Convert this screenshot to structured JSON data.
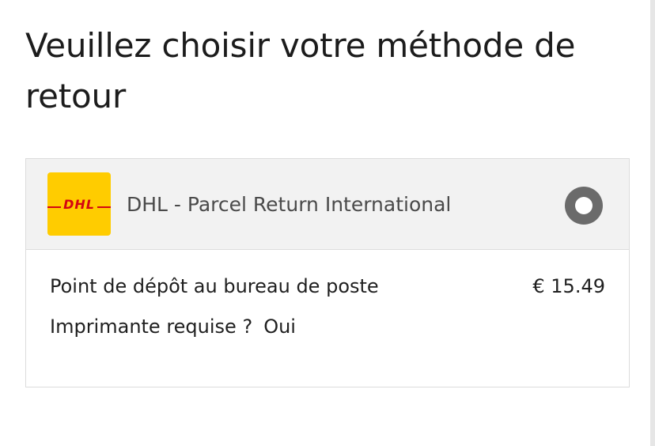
{
  "title": "Veuillez choisir votre méthode de retour",
  "method": {
    "carrier_logo_text": "DHL",
    "carrier_name": "DHL - Parcel Return International",
    "selected": false,
    "dropoff_label": "Point de dépôt au bureau de poste",
    "price": "€ 15.49",
    "printer_label": "Imprimante requise ?",
    "printer_value": "Oui"
  },
  "colors": {
    "logo_yellow": "#ffcc00",
    "logo_red": "#d40511",
    "header_bg": "#f2f2f2",
    "radio_ring": "#6b6b6b"
  },
  "icons": {
    "carrier": "dhl-logo-icon",
    "selection": "radio-unselected-icon"
  }
}
